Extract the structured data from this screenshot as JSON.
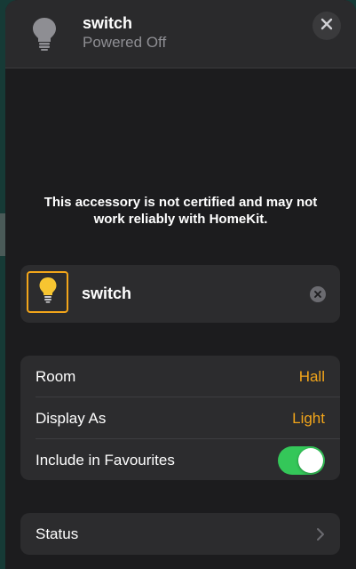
{
  "header": {
    "title": "switch",
    "subtitle": "Powered Off",
    "icon": "lightbulb-off-icon"
  },
  "warning": {
    "line1": "This accessory is not certified and may not",
    "line2": "work reliably with HomeKit."
  },
  "accessory": {
    "name": "switch",
    "icon": "lightbulb-on-icon"
  },
  "settings": {
    "room_label": "Room",
    "room_value": "Hall",
    "display_as_label": "Display As",
    "display_as_value": "Light",
    "favourites_label": "Include in Favourites",
    "favourites_on": true
  },
  "status": {
    "label": "Status"
  },
  "colors": {
    "accent": "#f2a51a",
    "toggle_on": "#34c759",
    "background": "#1c1c1e",
    "card": "#2c2c2e"
  }
}
